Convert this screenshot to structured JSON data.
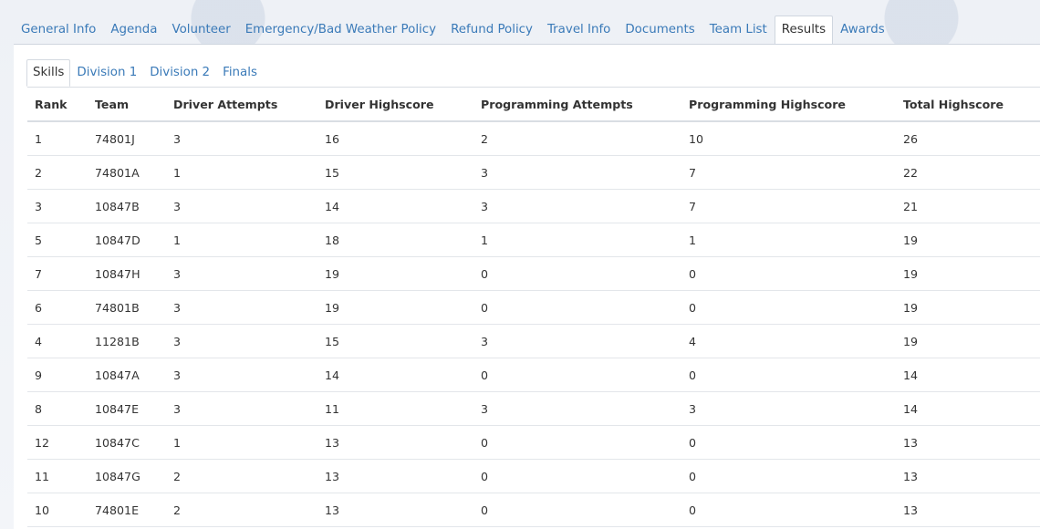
{
  "top_tabs": [
    {
      "label": "General Info",
      "active": false
    },
    {
      "label": "Agenda",
      "active": false
    },
    {
      "label": "Volunteer",
      "active": false
    },
    {
      "label": "Emergency/Bad Weather Policy",
      "active": false
    },
    {
      "label": "Refund Policy",
      "active": false
    },
    {
      "label": "Travel Info",
      "active": false
    },
    {
      "label": "Documents",
      "active": false
    },
    {
      "label": "Team List",
      "active": false
    },
    {
      "label": "Results",
      "active": true
    },
    {
      "label": "Awards",
      "active": false
    }
  ],
  "sub_tabs": [
    {
      "label": "Skills",
      "active": true
    },
    {
      "label": "Division 1",
      "active": false
    },
    {
      "label": "Division 2",
      "active": false
    },
    {
      "label": "Finals",
      "active": false
    }
  ],
  "table": {
    "headers": [
      "Rank",
      "Team",
      "Driver Attempts",
      "Driver Highscore",
      "Programming Attempts",
      "Programming Highscore",
      "Total Highscore"
    ],
    "rows": [
      [
        "1",
        "74801J",
        "3",
        "16",
        "2",
        "10",
        "26"
      ],
      [
        "2",
        "74801A",
        "1",
        "15",
        "3",
        "7",
        "22"
      ],
      [
        "3",
        "10847B",
        "3",
        "14",
        "3",
        "7",
        "21"
      ],
      [
        "5",
        "10847D",
        "1",
        "18",
        "1",
        "1",
        "19"
      ],
      [
        "7",
        "10847H",
        "3",
        "19",
        "0",
        "0",
        "19"
      ],
      [
        "6",
        "74801B",
        "3",
        "19",
        "0",
        "0",
        "19"
      ],
      [
        "4",
        "11281B",
        "3",
        "15",
        "3",
        "4",
        "19"
      ],
      [
        "9",
        "10847A",
        "3",
        "14",
        "0",
        "0",
        "14"
      ],
      [
        "8",
        "10847E",
        "3",
        "11",
        "3",
        "3",
        "14"
      ],
      [
        "12",
        "10847C",
        "1",
        "13",
        "0",
        "0",
        "13"
      ],
      [
        "11",
        "10847G",
        "2",
        "13",
        "0",
        "0",
        "13"
      ],
      [
        "10",
        "74801E",
        "2",
        "13",
        "0",
        "0",
        "13"
      ]
    ]
  },
  "colors": {
    "link": "#3a7ab8",
    "text": "#333333",
    "border": "#d9dde3"
  }
}
